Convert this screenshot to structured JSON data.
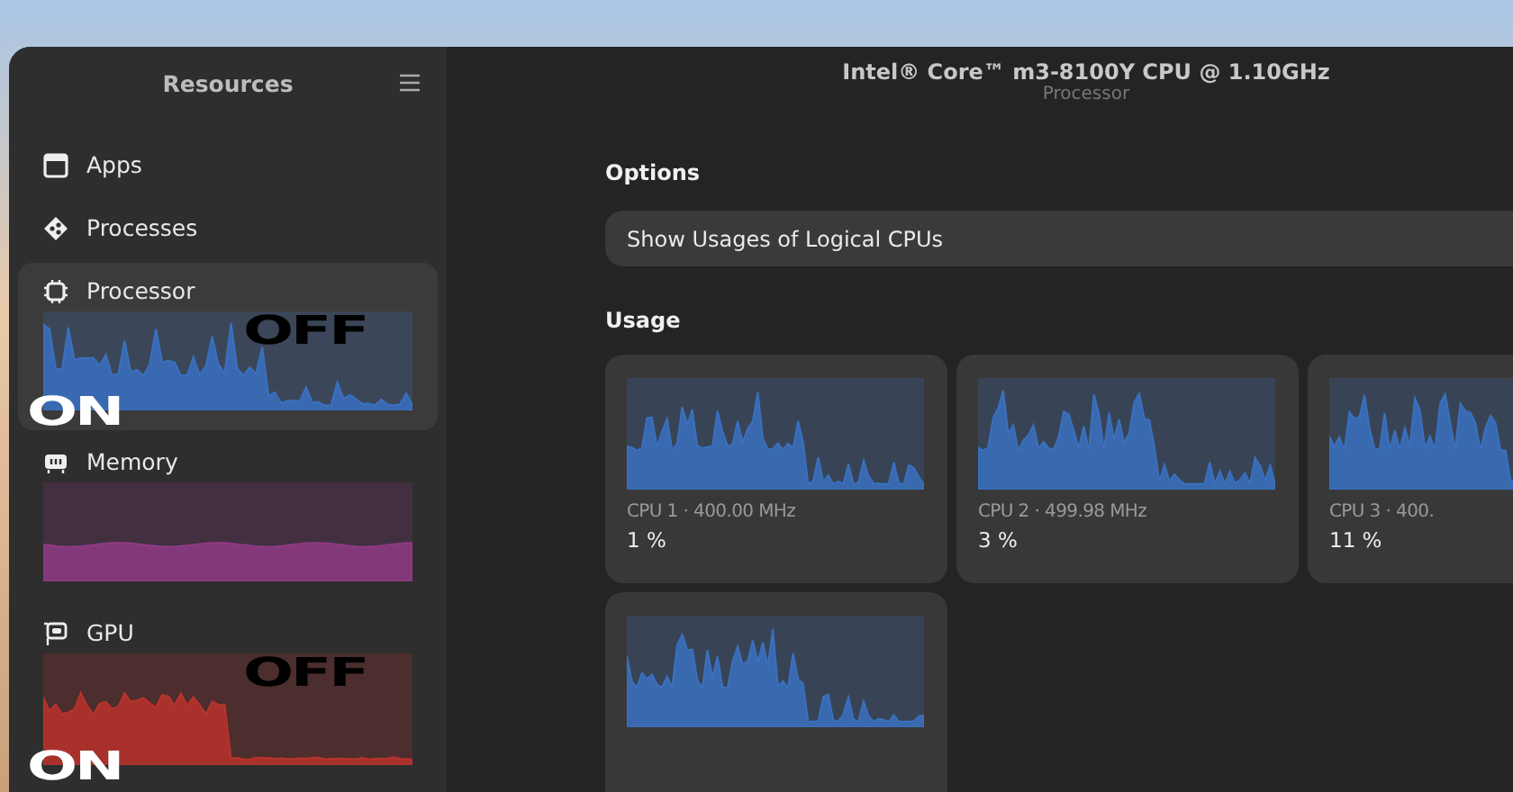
{
  "sidebar": {
    "title": "Resources",
    "items": [
      {
        "label": "Apps",
        "kind": "plain",
        "selected": false
      },
      {
        "label": "Processes",
        "kind": "plain",
        "selected": false
      },
      {
        "label": "Processor",
        "kind": "graph",
        "selected": true,
        "color": "#3a70c0",
        "overlays": [
          {
            "text": "OFF",
            "kind": "dark"
          },
          {
            "text": "ON",
            "kind": "light"
          }
        ]
      },
      {
        "label": "Memory",
        "kind": "graph",
        "selected": false,
        "color": "#8e3a85"
      },
      {
        "label": "GPU",
        "kind": "graph",
        "selected": false,
        "color": "#b8332c",
        "overlays": [
          {
            "text": "OFF",
            "kind": "dark"
          },
          {
            "text": "ON",
            "kind": "light"
          }
        ]
      }
    ]
  },
  "header": {
    "title": "Intel® Core™ m3-8100Y CPU @ 1.10GHz",
    "subtitle": "Processor"
  },
  "options": {
    "heading": "Options",
    "rows": [
      "Show Usages of Logical CPUs"
    ]
  },
  "usage": {
    "heading": "Usage",
    "cores": [
      {
        "kind": "full",
        "label": "CPU 1 · 400.00 MHz",
        "value": "1 %"
      },
      {
        "kind": "full",
        "label": "CPU 2 · 499.98 MHz",
        "value": "3 %"
      },
      {
        "kind": "full",
        "label": "CPU 3 · 400.",
        "value": "11 %"
      },
      {
        "kind": "graph"
      }
    ]
  }
}
